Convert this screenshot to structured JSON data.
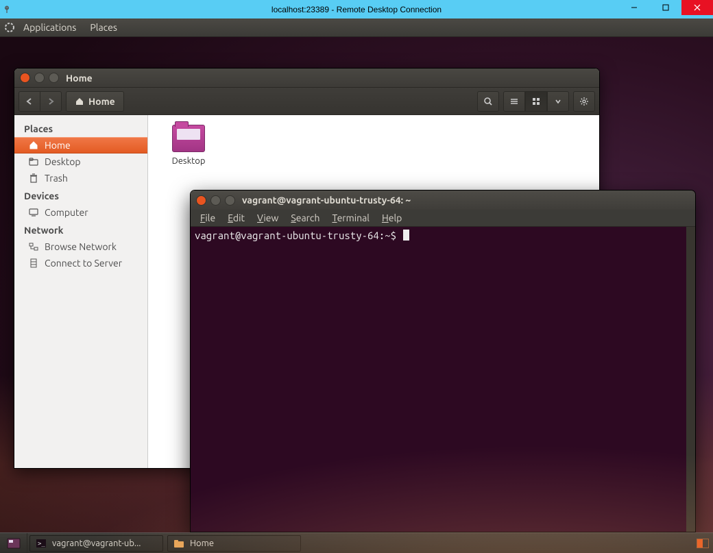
{
  "rdp": {
    "title": "localhost:23389 - Remote Desktop Connection"
  },
  "topbar": {
    "applications": "Applications",
    "places": "Places"
  },
  "nautilus": {
    "title": "Home",
    "path_label": "Home",
    "sidebar": {
      "places_heading": "Places",
      "home": "Home",
      "desktop": "Desktop",
      "trash": "Trash",
      "devices_heading": "Devices",
      "computer": "Computer",
      "network_heading": "Network",
      "browse_network": "Browse Network",
      "connect_server": "Connect to Server"
    },
    "content": {
      "desktop_folder": "Desktop"
    }
  },
  "terminal": {
    "title": "vagrant@vagrant-ubuntu-trusty-64: ~",
    "menus": {
      "file": "File",
      "edit": "Edit",
      "view": "View",
      "search": "Search",
      "terminal": "Terminal",
      "help": "Help"
    },
    "prompt": "vagrant@vagrant-ubuntu-trusty-64:~$ "
  },
  "taskbar": {
    "task_terminal": "vagrant@vagrant-ub...",
    "task_home": "Home"
  }
}
